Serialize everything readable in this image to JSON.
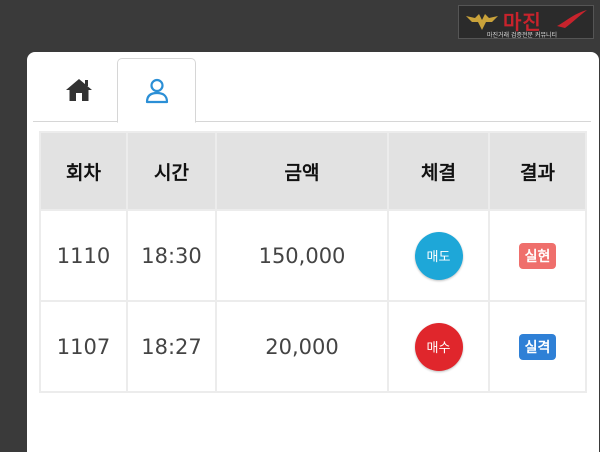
{
  "watermark": {
    "logo_text": "마진",
    "tagline": "마진거래 검증전문 커뮤니티"
  },
  "tabs": [
    {
      "icon": "home-icon",
      "active": false
    },
    {
      "icon": "user-icon",
      "active": true
    }
  ],
  "table": {
    "headers": [
      "회차",
      "시간",
      "금액",
      "체결",
      "결과"
    ],
    "rows": [
      {
        "round": "1110",
        "time": "18:30",
        "amount": "150,000",
        "trade": "매도",
        "result": "실현"
      },
      {
        "round": "1107",
        "time": "18:27",
        "amount": "20,000",
        "trade": "매수",
        "result": "실격"
      }
    ]
  },
  "colors": {
    "sell": "#1ea7d8",
    "buy": "#e0262c",
    "result_win": "#ef6f6c",
    "result_lose": "#2f80d6",
    "active_tab_icon": "#2b8fd6",
    "home_icon": "#333333"
  }
}
